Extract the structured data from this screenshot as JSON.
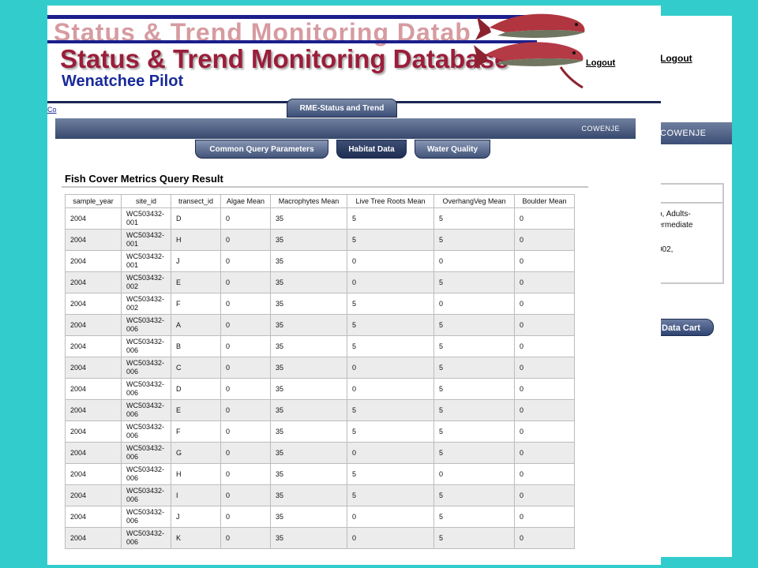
{
  "back_window": {
    "logout_label": "Logout",
    "user": "COWENJE",
    "fragments": [
      "o, Adults-",
      "ermediate",
      "002,"
    ],
    "data_cart_label": "Data Cart"
  },
  "header": {
    "ghost_title": "Status & Trend Monitoring Datab",
    "title": "Status & Trend Monitoring Database",
    "subtitle": "Wenatchee Pilot",
    "logout_label": "Logout",
    "side_fragment": "Co"
  },
  "nav": {
    "main_tab": "RME-Status and Trend",
    "user": "COWENJE",
    "sub_tabs": [
      {
        "label": "Common Query Parameters"
      },
      {
        "label": "Habitat Data",
        "active": true
      },
      {
        "label": "Water Quality"
      }
    ]
  },
  "result": {
    "title": "Fish Cover Metrics Query Result",
    "columns": [
      "sample_year",
      "site_id",
      "transect_id",
      "Algae Mean",
      "Macrophytes Mean",
      "Live Tree Roots Mean",
      "OverhangVeg Mean",
      "Boulder Mean"
    ],
    "rows": [
      [
        "2004",
        "WC503432-001",
        "D",
        "0",
        "35",
        "5",
        "5",
        "0"
      ],
      [
        "2004",
        "WC503432-001",
        "H",
        "0",
        "35",
        "5",
        "5",
        "0"
      ],
      [
        "2004",
        "WC503432-001",
        "J",
        "0",
        "35",
        "0",
        "0",
        "0"
      ],
      [
        "2004",
        "WC503432-002",
        "E",
        "0",
        "35",
        "0",
        "5",
        "0"
      ],
      [
        "2004",
        "WC503432-002",
        "F",
        "0",
        "35",
        "5",
        "0",
        "0"
      ],
      [
        "2004",
        "WC503432-006",
        "A",
        "0",
        "35",
        "5",
        "5",
        "0"
      ],
      [
        "2004",
        "WC503432-006",
        "B",
        "0",
        "35",
        "5",
        "5",
        "0"
      ],
      [
        "2004",
        "WC503432-006",
        "C",
        "0",
        "35",
        "0",
        "5",
        "0"
      ],
      [
        "2004",
        "WC503432-006",
        "D",
        "0",
        "35",
        "0",
        "5",
        "0"
      ],
      [
        "2004",
        "WC503432-006",
        "E",
        "0",
        "35",
        "5",
        "5",
        "0"
      ],
      [
        "2004",
        "WC503432-006",
        "F",
        "0",
        "35",
        "5",
        "5",
        "0"
      ],
      [
        "2004",
        "WC503432-006",
        "G",
        "0",
        "35",
        "0",
        "5",
        "0"
      ],
      [
        "2004",
        "WC503432-006",
        "H",
        "0",
        "35",
        "5",
        "0",
        "0"
      ],
      [
        "2004",
        "WC503432-006",
        "I",
        "0",
        "35",
        "5",
        "5",
        "0"
      ],
      [
        "2004",
        "WC503432-006",
        "J",
        "0",
        "35",
        "0",
        "5",
        "0"
      ],
      [
        "2004",
        "WC503432-006",
        "K",
        "0",
        "35",
        "0",
        "5",
        "0"
      ]
    ]
  },
  "colors": {
    "background": "#33cccc",
    "title": "#9a1e3a",
    "subtitle": "#1a2a9a",
    "nav_bar": "#3d4f78"
  }
}
